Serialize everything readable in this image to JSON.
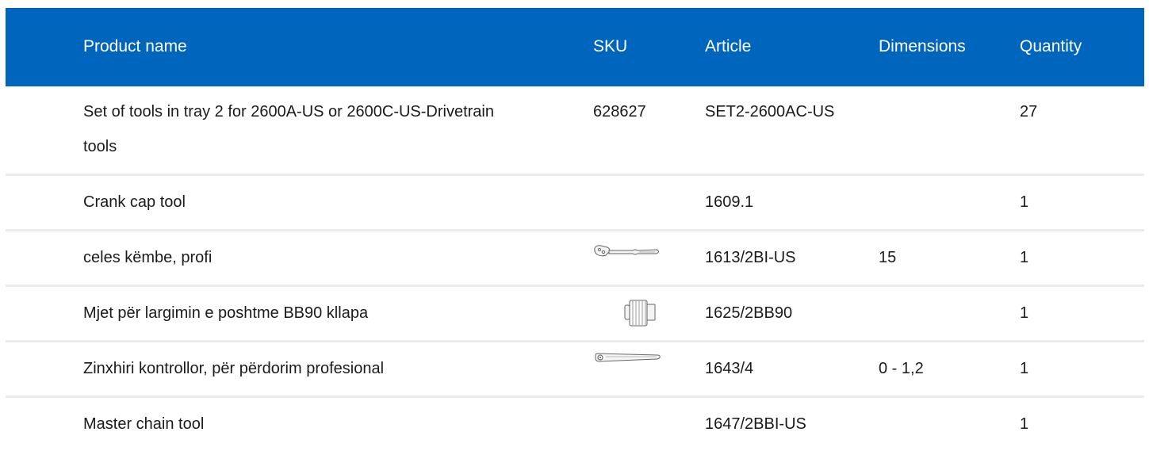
{
  "headers": {
    "product_name": "Product name",
    "sku": "SKU",
    "article": "Article",
    "dimensions": "Dimensions",
    "quantity": "Quantity"
  },
  "rows": [
    {
      "name": "Set of tools in tray 2 for 2600A-US or 2600C-US-Drivetrain tools",
      "sku": "628627",
      "sku_icon": "",
      "article": "SET2-2600AC-US",
      "dimensions": "",
      "quantity": "27"
    },
    {
      "name": "Crank cap tool",
      "sku": "",
      "sku_icon": "",
      "article": "1609.1",
      "dimensions": "",
      "quantity": "1"
    },
    {
      "name": "celes këmbe, profi",
      "sku": "",
      "sku_icon": "pedal-wrench-icon",
      "article": "1613/2BI-US",
      "dimensions": "15",
      "quantity": "1"
    },
    {
      "name": "Mjet për largimin e poshtme BB90 kllapa",
      "sku": "",
      "sku_icon": "bb90-remover-icon",
      "article": "1625/2BB90",
      "dimensions": "",
      "quantity": "1"
    },
    {
      "name": "Zinxhiri kontrollor, për përdorim profesional",
      "sku": "",
      "sku_icon": "chain-checker-icon",
      "article": "1643/4",
      "dimensions": "0 - 1,2",
      "quantity": "1"
    },
    {
      "name": "Master chain tool",
      "sku": "",
      "sku_icon": "",
      "article": "1647/2BBI-US",
      "dimensions": "",
      "quantity": "1"
    }
  ]
}
